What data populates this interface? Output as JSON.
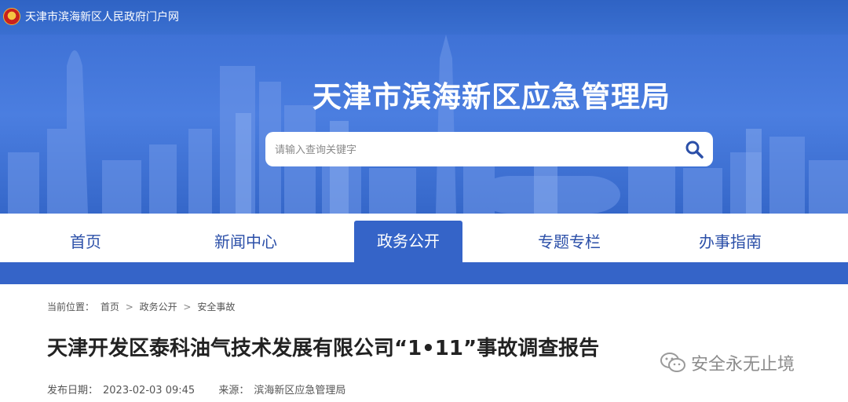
{
  "portal": {
    "name": "天津市滨海新区人民政府门户网"
  },
  "banner": {
    "title": "天津市滨海新区应急管理局"
  },
  "search": {
    "placeholder": "请输入查询关键字"
  },
  "nav": {
    "items": [
      {
        "label": "首页"
      },
      {
        "label": "新闻中心"
      },
      {
        "label": "政务公开",
        "active": true
      },
      {
        "label": "专题专栏"
      },
      {
        "label": "办事指南"
      }
    ]
  },
  "breadcrumb": {
    "prefix": "当前位置：",
    "items": [
      "首页",
      "政务公开",
      "安全事故"
    ],
    "separator": ">"
  },
  "article": {
    "title": "天津开发区泰科油气技术发展有限公司“1•11”事故调查报告",
    "date_label": "发布日期：",
    "date": "2023-02-03 09:45",
    "source_label": "来源：",
    "source": "滨海新区应急管理局"
  },
  "watermark": {
    "text": "安全永无止境",
    "icon": "wechat-icon"
  },
  "colors": {
    "primary": "#3564c8",
    "banner": "#4b7ee0",
    "nav_text": "#2b4fa8"
  }
}
